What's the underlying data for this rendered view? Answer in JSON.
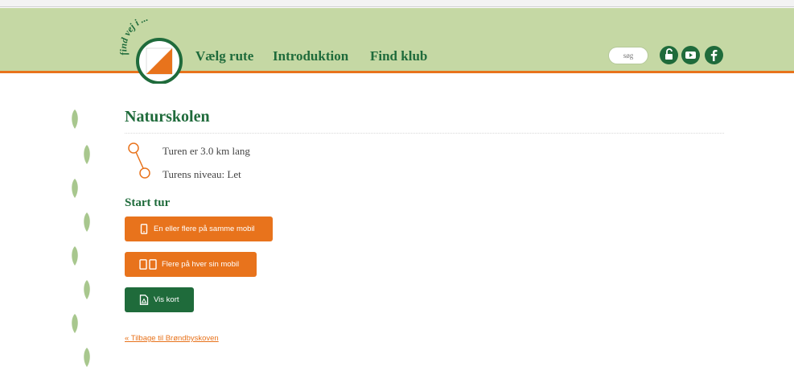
{
  "logo": {
    "text": "find vej i ...",
    "icon": "orienteering-flag-icon"
  },
  "nav": {
    "items": [
      "Vælg rute",
      "Introduktion",
      "Find klub"
    ]
  },
  "search": {
    "placeholder": "søg"
  },
  "social": {
    "icons": [
      "lock-icon",
      "youtube-icon",
      "facebook-icon"
    ]
  },
  "page": {
    "title": "Naturskolen",
    "route_length": "Turen er 3.0 km lang",
    "route_level": "Turens niveau: Let",
    "start_heading": "Start tur",
    "buttons": {
      "same_mobile": "En eller flere på samme mobil",
      "each_mobile": "Flere på hver sin mobil",
      "show_map": "Vis kort"
    },
    "back_link": "« Tilbage til Brøndbyskoven"
  },
  "colors": {
    "green": "#1f6b3b",
    "orange": "#e8731c",
    "header_bg": "#c5d8a4"
  }
}
